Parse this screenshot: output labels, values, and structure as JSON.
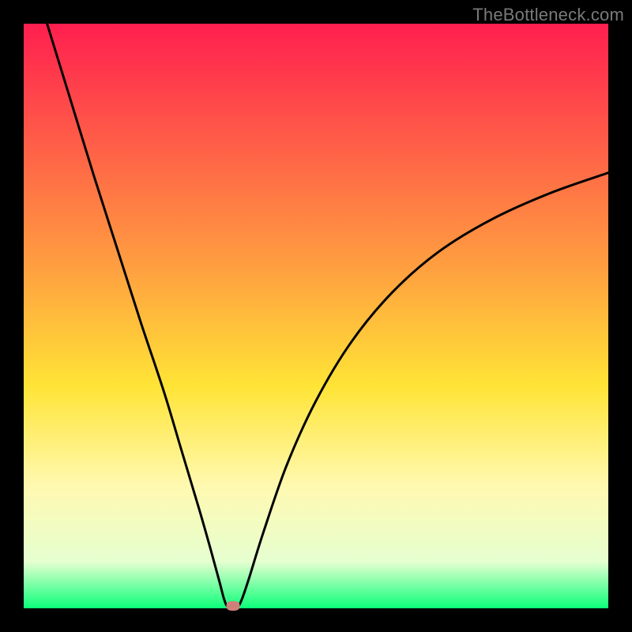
{
  "watermark": "TheBottleneck.com",
  "chart_data": {
    "type": "line",
    "title": "",
    "xlabel": "",
    "ylabel": "",
    "x_range": [
      0,
      100
    ],
    "y_range": [
      0,
      100
    ],
    "gradient_stops": [
      {
        "pct": 0,
        "color": "#ff1f4f"
      },
      {
        "pct": 42,
        "color": "#ffa040"
      },
      {
        "pct": 62,
        "color": "#ffe436"
      },
      {
        "pct": 79,
        "color": "#fff9b0"
      },
      {
        "pct": 92,
        "color": "#e6ffd0"
      },
      {
        "pct": 100,
        "color": "#0cff7a"
      }
    ],
    "series": [
      {
        "name": "bottleneck-curve",
        "color": "#000000",
        "points": [
          {
            "x": 4.0,
            "y": 100.0
          },
          {
            "x": 8.0,
            "y": 87.0
          },
          {
            "x": 12.0,
            "y": 74.0
          },
          {
            "x": 16.0,
            "y": 61.5
          },
          {
            "x": 20.0,
            "y": 49.0
          },
          {
            "x": 24.0,
            "y": 37.0
          },
          {
            "x": 27.0,
            "y": 27.0
          },
          {
            "x": 30.0,
            "y": 17.0
          },
          {
            "x": 32.0,
            "y": 10.0
          },
          {
            "x": 33.5,
            "y": 4.5
          },
          {
            "x": 34.3,
            "y": 1.5
          },
          {
            "x": 35.0,
            "y": 0.2
          },
          {
            "x": 36.5,
            "y": 0.2
          },
          {
            "x": 37.3,
            "y": 1.5
          },
          {
            "x": 38.5,
            "y": 5.0
          },
          {
            "x": 41.0,
            "y": 13.0
          },
          {
            "x": 45.0,
            "y": 24.5
          },
          {
            "x": 50.0,
            "y": 35.5
          },
          {
            "x": 56.0,
            "y": 45.5
          },
          {
            "x": 63.0,
            "y": 54.0
          },
          {
            "x": 71.0,
            "y": 61.0
          },
          {
            "x": 80.0,
            "y": 66.5
          },
          {
            "x": 90.0,
            "y": 71.0
          },
          {
            "x": 100.0,
            "y": 74.5
          }
        ]
      }
    ],
    "marker": {
      "x": 35.8,
      "y": 0.4,
      "color": "#cf8079"
    }
  }
}
